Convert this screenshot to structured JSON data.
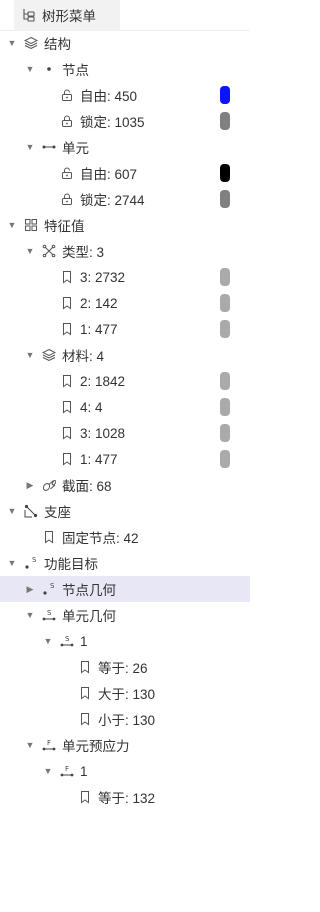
{
  "tab": {
    "label": "树形菜单"
  },
  "tree": {
    "structure": {
      "label": "结构",
      "nodes": {
        "label": "节点",
        "free": {
          "label": "自由: 450",
          "color": "#0a14ff"
        },
        "locked": {
          "label": "锁定: 1035",
          "color": "#808080"
        }
      },
      "elements": {
        "label": "单元",
        "free": {
          "label": "自由: 607",
          "color": "#000000"
        },
        "locked": {
          "label": "锁定: 2744",
          "color": "#808080"
        }
      }
    },
    "features": {
      "label": "特征值",
      "types": {
        "label": "类型: 3",
        "items": [
          {
            "label": "3: 2732",
            "color": "#aaaaaa"
          },
          {
            "label": "2: 142",
            "color": "#aaaaaa"
          },
          {
            "label": "1: 477",
            "color": "#aaaaaa"
          }
        ]
      },
      "materials": {
        "label": "材料: 4",
        "items": [
          {
            "label": "2: 1842",
            "color": "#aaaaaa"
          },
          {
            "label": "4: 4",
            "color": "#aaaaaa"
          },
          {
            "label": "3: 1028",
            "color": "#aaaaaa"
          },
          {
            "label": "1: 477",
            "color": "#aaaaaa"
          }
        ]
      },
      "sections": {
        "label": "截面: 68"
      }
    },
    "supports": {
      "label": "支座",
      "fixed": {
        "label": "固定节点: 42"
      }
    },
    "objectives": {
      "label": "功能目标",
      "node_geometry": {
        "label": "节点几何"
      },
      "element_geometry": {
        "label": "单元几何",
        "group": {
          "label": "1",
          "items": [
            {
              "label": "等于: 26"
            },
            {
              "label": "大于: 130"
            },
            {
              "label": "小于: 130"
            }
          ]
        }
      },
      "prestress": {
        "label": "单元预应力",
        "group": {
          "label": "1",
          "items": [
            {
              "label": "等于: 132"
            }
          ]
        }
      }
    }
  }
}
